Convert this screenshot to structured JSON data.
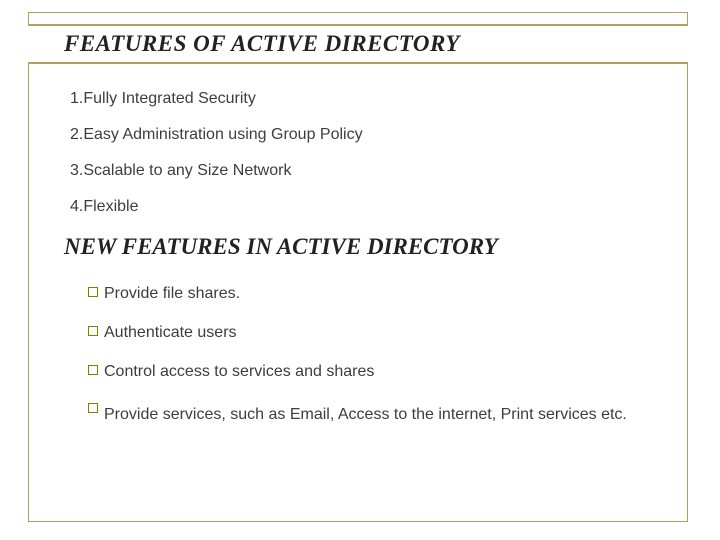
{
  "heading1": "FEATURES OF ACTIVE DIRECTORY",
  "features": [
    "1.Fully Integrated Security",
    "2.Easy Administration using Group Policy",
    "3.Scalable to any Size Network",
    "4.Flexible"
  ],
  "heading2": "NEW FEATURES IN ACTIVE DIRECTORY",
  "new_features": [
    "Provide file shares.",
    " Authenticate users",
    "Control access to services and shares",
    " Provide services, such as Email, Access to the internet, Print services etc."
  ]
}
